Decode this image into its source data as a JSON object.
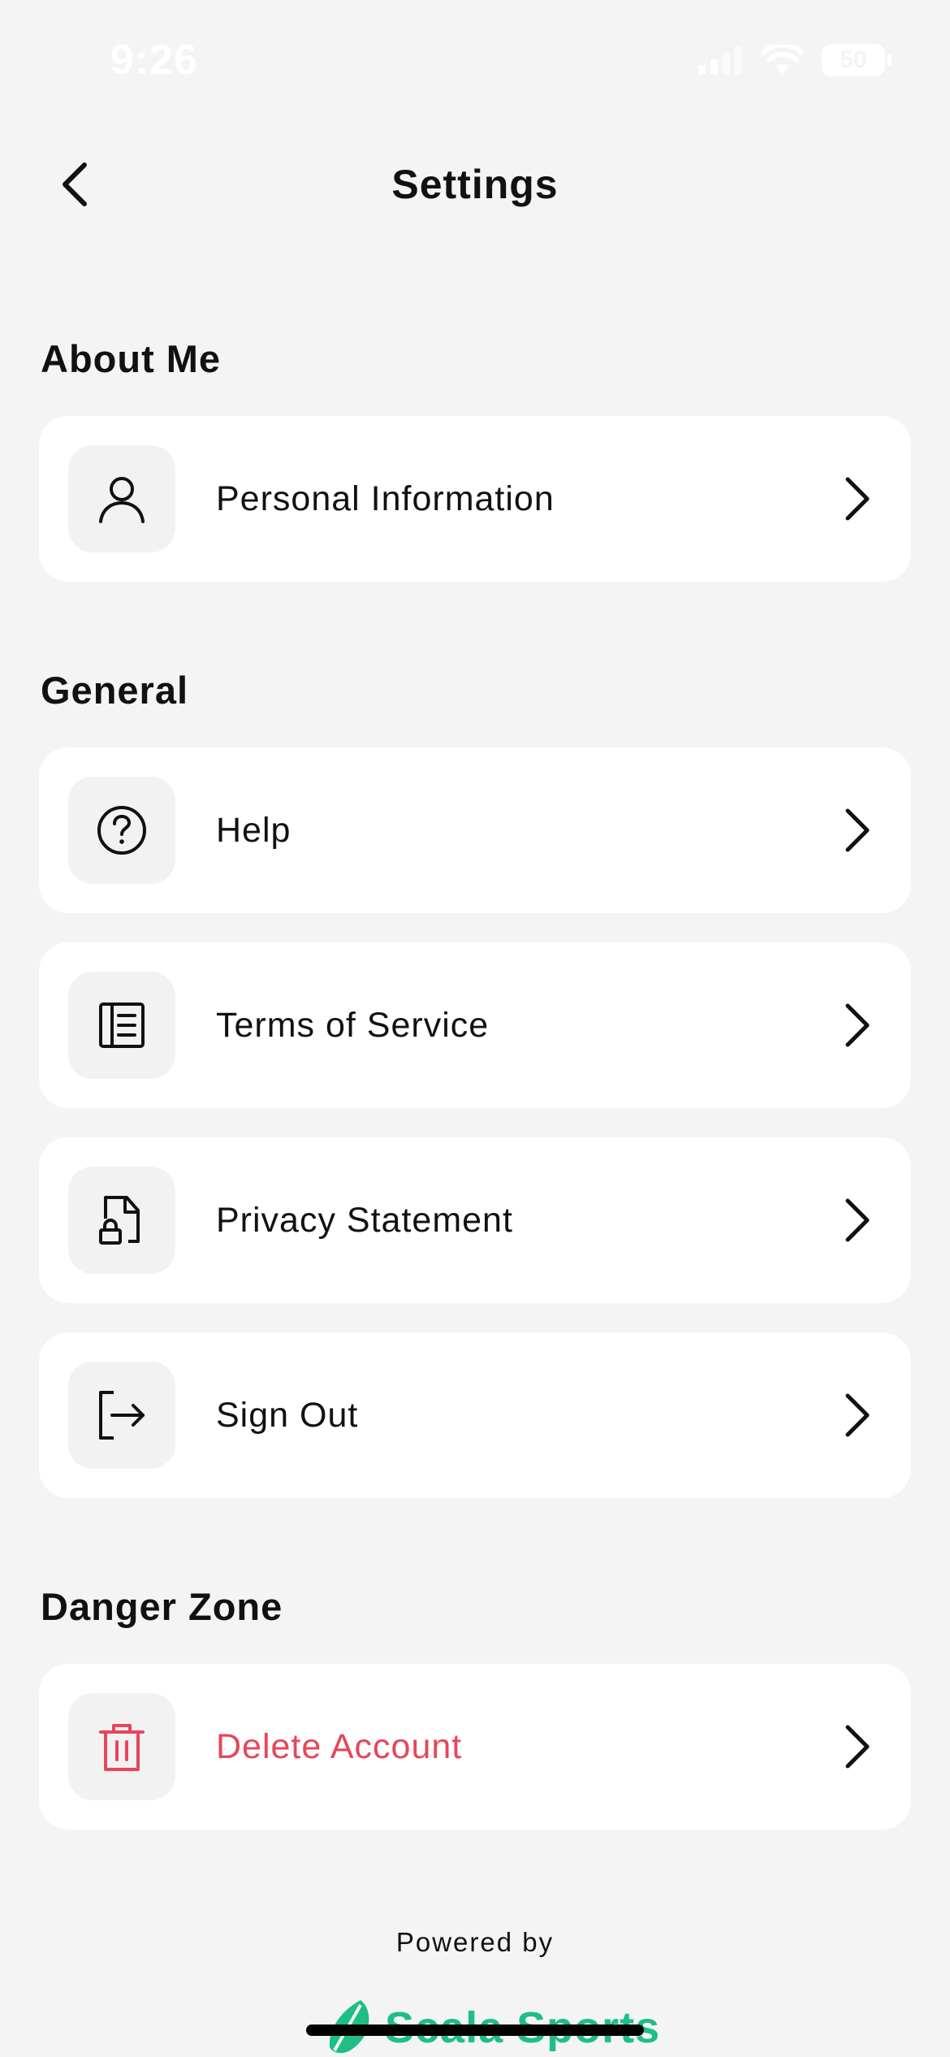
{
  "status_bar": {
    "time": "9:26",
    "battery": "50"
  },
  "nav": {
    "title": "Settings"
  },
  "sections": {
    "about": {
      "title": "About Me",
      "items": [
        {
          "label": "Personal Information",
          "icon": "person-icon"
        }
      ]
    },
    "general": {
      "title": "General",
      "items": [
        {
          "label": "Help",
          "icon": "help-circle-icon"
        },
        {
          "label": "Terms of Service",
          "icon": "document-icon"
        },
        {
          "label": "Privacy Statement",
          "icon": "locked-file-icon"
        },
        {
          "label": "Sign Out",
          "icon": "sign-out-icon"
        }
      ]
    },
    "danger": {
      "title": "Danger Zone",
      "items": [
        {
          "label": "Delete Account",
          "icon": "trash-icon"
        }
      ]
    }
  },
  "footer": {
    "powered_by": "Powered by",
    "brand": "Scala Sports"
  },
  "colors": {
    "background": "#f4f4f4",
    "card": "#ffffff",
    "danger": "#e8455a",
    "brand": "#1dbf85"
  }
}
